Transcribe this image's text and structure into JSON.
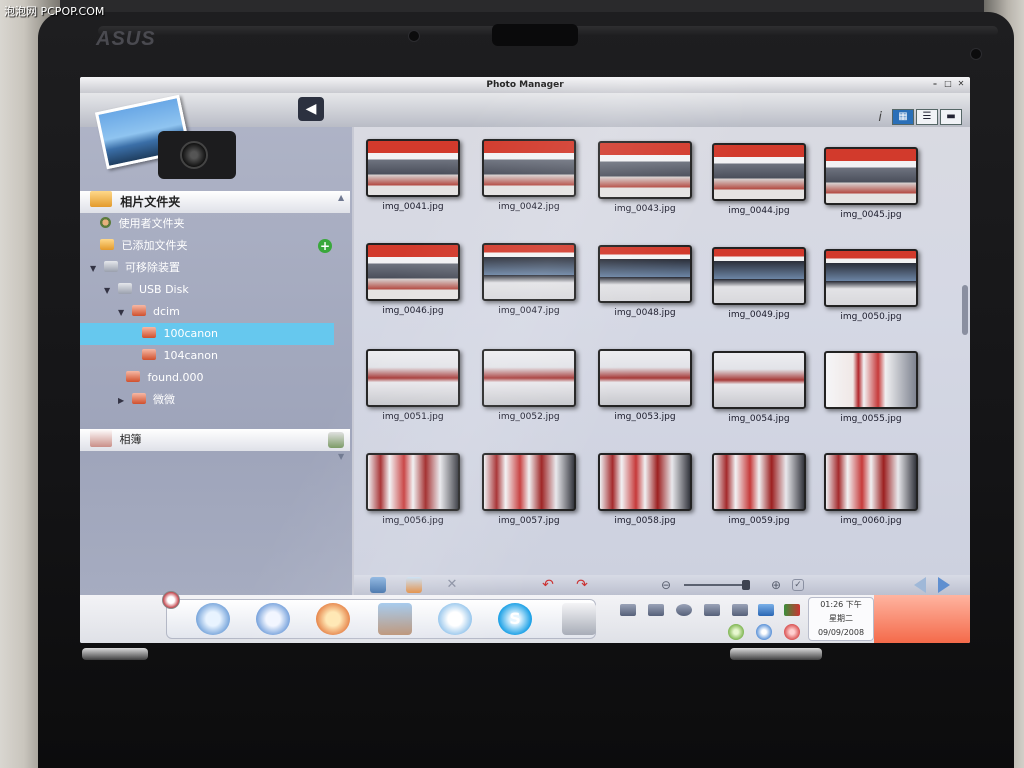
{
  "watermark": "泡泡网 PCPOP.COM",
  "device": {
    "brand_logo": "ASUS"
  },
  "window": {
    "title": "Photo Manager"
  },
  "sidebar": {
    "header": "相片文件夹",
    "items": [
      {
        "label": "使用者文件夹",
        "icon": "user-icon"
      },
      {
        "label": "已添加文件夹",
        "icon": "folder-icon"
      },
      {
        "label": "可移除装置",
        "icon": "drive-icon"
      },
      {
        "label": "USB Disk",
        "icon": "usb-drive-icon"
      },
      {
        "label": "dcim",
        "icon": "folder-icon"
      },
      {
        "label": "100canon",
        "icon": "folder-icon",
        "selected": true
      },
      {
        "label": "104canon",
        "icon": "folder-icon"
      },
      {
        "label": "found.000",
        "icon": "folder-icon"
      },
      {
        "label": "微微",
        "icon": "folder-icon"
      }
    ],
    "album": "相簿"
  },
  "photos": [
    {
      "name": "img_0041.jpg",
      "scene": "red-banner-display"
    },
    {
      "name": "img_0042.jpg",
      "scene": "red-banner-display"
    },
    {
      "name": "img_0043.jpg",
      "scene": "red-banner-display"
    },
    {
      "name": "img_0044.jpg",
      "scene": "red-banner-display"
    },
    {
      "name": "img_0045.jpg",
      "scene": "red-banner-display"
    },
    {
      "name": "img_0046.jpg",
      "scene": "red-banner-display"
    },
    {
      "name": "img_0047.jpg",
      "scene": "monitor-display"
    },
    {
      "name": "img_0048.jpg",
      "scene": "monitor-display"
    },
    {
      "name": "img_0049.jpg",
      "scene": "monitor-display"
    },
    {
      "name": "img_0050.jpg",
      "scene": "monitor-display"
    },
    {
      "name": "img_0051.jpg",
      "scene": "tray"
    },
    {
      "name": "img_0052.jpg",
      "scene": "tray"
    },
    {
      "name": "img_0053.jpg",
      "scene": "tray"
    },
    {
      "name": "img_0054.jpg",
      "scene": "tray"
    },
    {
      "name": "img_0055.jpg",
      "scene": "product-box"
    },
    {
      "name": "img_0056.jpg",
      "scene": "product-boxes"
    },
    {
      "name": "img_0057.jpg",
      "scene": "product-boxes"
    },
    {
      "name": "img_0058.jpg",
      "scene": "product-boxes"
    },
    {
      "name": "img_0059.jpg",
      "scene": "product-boxes"
    },
    {
      "name": "img_0060.jpg",
      "scene": "product-boxes"
    }
  ],
  "taskbar": {
    "clock_time": "01:26 下午",
    "clock_day": "星期二",
    "clock_date": "09/09/2008"
  },
  "colors": {
    "selection": "#66c8ee",
    "dock_accent": "#f46a4a",
    "view_active": "#2a6fb8"
  }
}
